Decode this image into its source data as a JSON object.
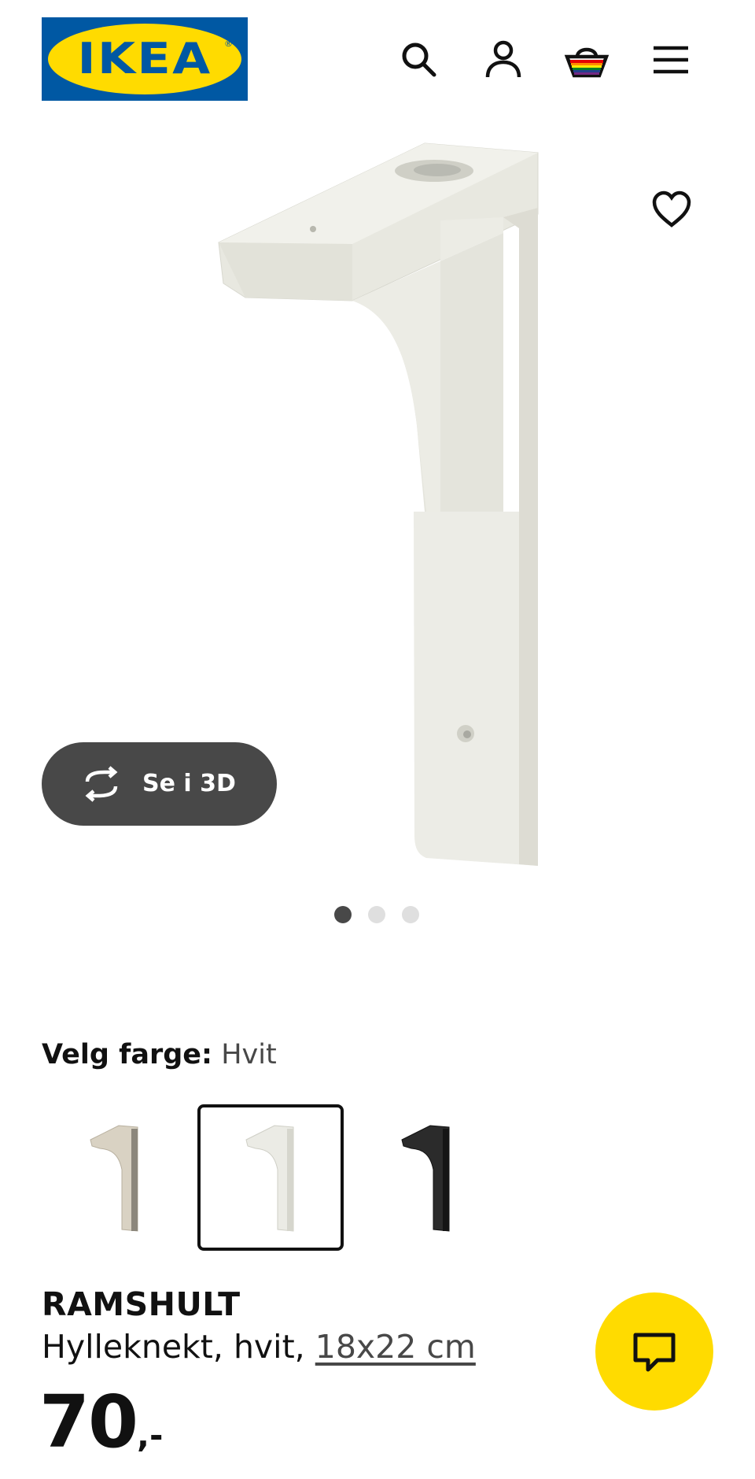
{
  "brand": {
    "logo_text": "IKEA",
    "logo_mark": "®",
    "blue": "#0058a3",
    "yellow": "#ffdb00"
  },
  "header": {
    "icons": [
      "search-icon",
      "account-icon",
      "basket-icon",
      "menu-icon"
    ]
  },
  "gallery": {
    "view_3d_label": "Se i 3D",
    "favourite_icon": "heart-icon",
    "image_count": 3,
    "active_image_index": 0
  },
  "color_picker": {
    "label": "Velg farge:",
    "selected_value": "Hvit",
    "options": [
      {
        "name": "beige",
        "color": "#d9d2c3"
      },
      {
        "name": "hvit",
        "color": "#ebebe5",
        "selected": true
      },
      {
        "name": "svart",
        "color": "#2b2b2b"
      }
    ]
  },
  "product": {
    "name": "RAMSHULT",
    "description": "Hylleknekt, hvit,",
    "size_link": "18x22 cm",
    "price": "70",
    "price_suffix": ",-"
  },
  "chat": {
    "icon": "chat-icon",
    "color": "#ffdb00"
  }
}
